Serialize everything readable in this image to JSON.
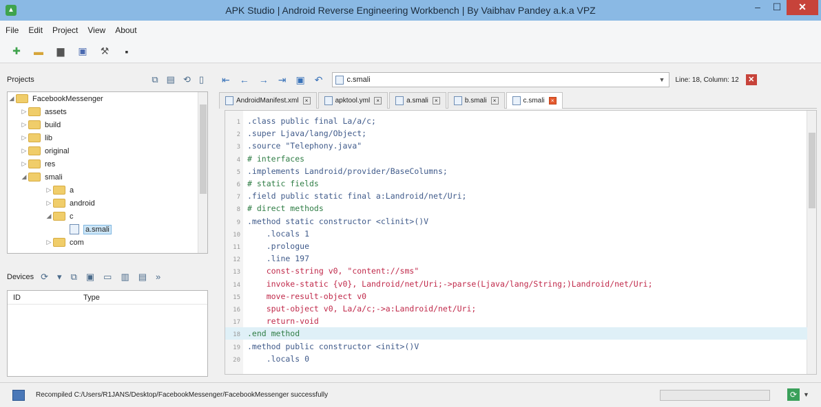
{
  "window": {
    "title": "APK Studio | Android Reverse Engineering Workbench | By Vaibhav Pandey a.k.a VPZ"
  },
  "menu": [
    "File",
    "Edit",
    "Project",
    "View",
    "About"
  ],
  "projects": {
    "label": "Projects",
    "tree": [
      {
        "label": "FacebookMessenger",
        "level": 0,
        "type": "folder",
        "expanded": true
      },
      {
        "label": "assets",
        "level": 1,
        "type": "folder"
      },
      {
        "label": "build",
        "level": 1,
        "type": "folder"
      },
      {
        "label": "lib",
        "level": 1,
        "type": "folder"
      },
      {
        "label": "original",
        "level": 1,
        "type": "folder"
      },
      {
        "label": "res",
        "level": 1,
        "type": "folder"
      },
      {
        "label": "smali",
        "level": 1,
        "type": "folder",
        "expanded": true
      },
      {
        "label": "a",
        "level": 2,
        "type": "folder"
      },
      {
        "label": "android",
        "level": 2,
        "type": "folder"
      },
      {
        "label": "c",
        "level": 2,
        "type": "folder",
        "expanded": true
      },
      {
        "label": "a.smali",
        "level": 3,
        "type": "file",
        "selected": true
      },
      {
        "label": "com",
        "level": 2,
        "type": "folder"
      }
    ]
  },
  "devices": {
    "label": "Devices",
    "columns": [
      "ID",
      "Type"
    ]
  },
  "editor": {
    "current_file": "c.smali",
    "position": "Line: 18, Column: 12",
    "tabs": [
      {
        "label": "AndroidManifest.xml",
        "active": false
      },
      {
        "label": "apktool.yml",
        "active": false
      },
      {
        "label": "a.smali",
        "active": false
      },
      {
        "label": "b.smali",
        "active": false
      },
      {
        "label": "c.smali",
        "active": true
      }
    ],
    "lines": [
      {
        "n": "1",
        "text": ".class public final La/a/c;",
        "kind": "dir"
      },
      {
        "n": "2",
        "text": ".super Ljava/lang/Object;",
        "kind": "dir"
      },
      {
        "n": "3",
        "text": ".source \"Telephony.java\"",
        "kind": "dir"
      },
      {
        "n": "4",
        "text": "# interfaces",
        "kind": "cmt"
      },
      {
        "n": "5",
        "text": ".implements Landroid/provider/BaseColumns;",
        "kind": "dir"
      },
      {
        "n": "6",
        "text": "# static fields",
        "kind": "cmt"
      },
      {
        "n": "7",
        "text": ".field public static final a:Landroid/net/Uri;",
        "kind": "dir"
      },
      {
        "n": "8",
        "text": "# direct methods",
        "kind": "cmt"
      },
      {
        "n": "9",
        "text": ".method static constructor <clinit>()V",
        "kind": "dir"
      },
      {
        "n": "10",
        "text": "    .locals 1",
        "kind": "dir"
      },
      {
        "n": "11",
        "text": "    .prologue",
        "kind": "dir"
      },
      {
        "n": "12",
        "text": "    .line 197",
        "kind": "dir"
      },
      {
        "n": "13",
        "text": "    const-string v0, \"content://sms\"",
        "kind": "ins"
      },
      {
        "n": "14",
        "text": "    invoke-static {v0}, Landroid/net/Uri;->parse(Ljava/lang/String;)Landroid/net/Uri;",
        "kind": "ins"
      },
      {
        "n": "15",
        "text": "    move-result-object v0",
        "kind": "ins"
      },
      {
        "n": "16",
        "text": "    sput-object v0, La/a/c;->a:Landroid/net/Uri;",
        "kind": "ins"
      },
      {
        "n": "17",
        "text": "    return-void",
        "kind": "ins"
      },
      {
        "n": "18",
        "text": ".end method",
        "kind": "cmt",
        "highlight": true
      },
      {
        "n": "19",
        "text": ".method public constructor <init>()V",
        "kind": "dir"
      },
      {
        "n": "20",
        "text": "    .locals 0",
        "kind": "dir"
      }
    ]
  },
  "status": {
    "message": "Recompiled C:/Users/R1JANS/Desktop/FacebookMessenger/FacebookMessenger successfully"
  },
  "icons": {
    "app": "android-icon",
    "toolbar": [
      "android-icon",
      "folder-open-icon",
      "print-icon",
      "save-icon",
      "wrench-icon",
      "terminal-icon"
    ],
    "nav": [
      "first-icon",
      "back-icon",
      "forward-icon",
      "last-icon",
      "save-icon",
      "undo-icon"
    ]
  },
  "colors": {
    "titlebar": "#8ab9e4",
    "close_button": "#c7433a",
    "highlight_line": "#dff0f7"
  }
}
